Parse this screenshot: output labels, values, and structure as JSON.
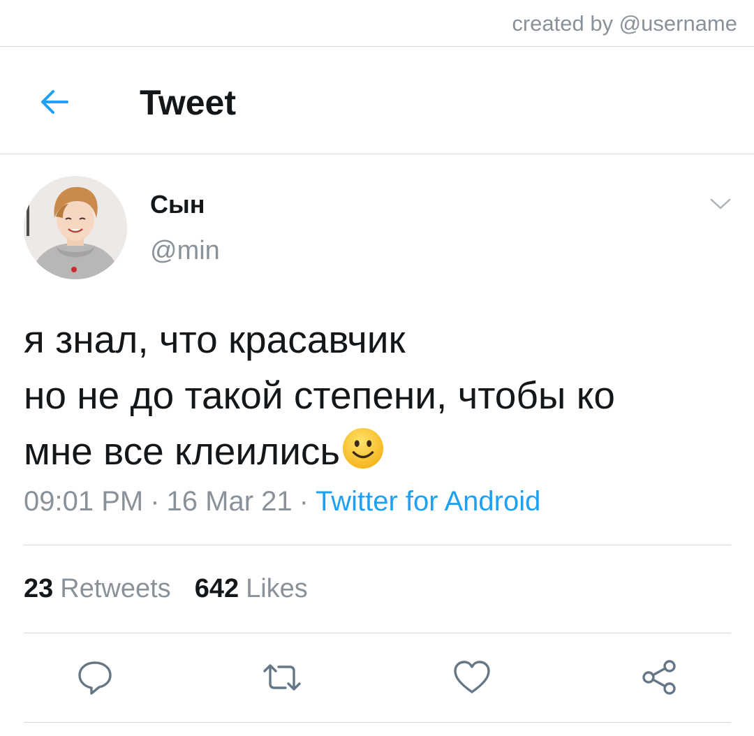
{
  "credit": "created by @username",
  "header": {
    "title": "Tweet",
    "back_icon": "arrow-left-icon"
  },
  "author": {
    "display_name": "Сын",
    "handle": "@min",
    "menu_icon": "chevron-down-icon"
  },
  "tweet": {
    "lines": [
      "я знал, что красавчик",
      "но не до такой степени, чтобы ко",
      "мне все клеились"
    ],
    "emoji": "slightly-smiling-face"
  },
  "meta": {
    "time": "09:01 PM",
    "separator": "·",
    "date": "16 Mar 21",
    "source": "Twitter for Android"
  },
  "stats": {
    "retweets_count": "23",
    "retweets_label": "Retweets",
    "likes_count": "642",
    "likes_label": "Likes"
  },
  "actions": [
    {
      "name": "reply",
      "icon": "speech-bubble-icon"
    },
    {
      "name": "retweet",
      "icon": "retweet-icon"
    },
    {
      "name": "like",
      "icon": "heart-icon"
    },
    {
      "name": "share",
      "icon": "share-icon"
    }
  ],
  "colors": {
    "accent": "#1da1f2",
    "text_primary": "#14171a",
    "text_secondary": "#8a9199",
    "divider": "#d6dbdf"
  }
}
